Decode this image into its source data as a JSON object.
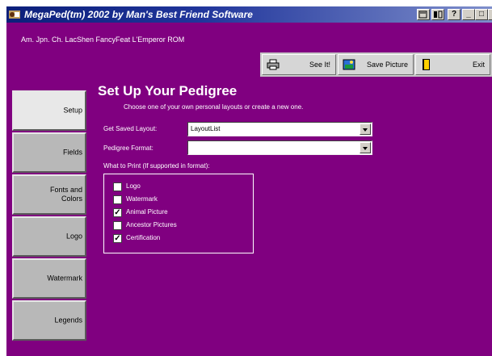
{
  "window": {
    "title": "MegaPed(tm) 2002 by Man's Best Friend Software",
    "controls": [
      "?",
      "_",
      "□",
      "×"
    ]
  },
  "breed_line": "Am. Jpn. Ch. LacShen FancyFeat L'Emperor ROM",
  "toolbar": {
    "see_it": "See It!",
    "save_picture": "Save Picture",
    "exit": "Exit"
  },
  "sidebar": {
    "items": [
      {
        "label": "Setup",
        "active": true
      },
      {
        "label": "Fields",
        "active": false
      },
      {
        "label": "Fonts and\nColors",
        "active": false
      },
      {
        "label": "Logo",
        "active": false
      },
      {
        "label": "Watermark",
        "active": false
      },
      {
        "label": "Legends",
        "active": false
      }
    ]
  },
  "main": {
    "heading": "Set Up Your Pedigree",
    "subtitle": "Choose one of your own personal layouts or create a new one.",
    "saved_layout_label": "Get Saved Layout:",
    "saved_layout_value": "LayoutList",
    "pedigree_format_label": "Pedigree Format:",
    "pedigree_format_value": "",
    "print_group_label": "What to Print (If supported in format):",
    "print_options": [
      {
        "label": "Logo",
        "checked": false
      },
      {
        "label": "Watermark",
        "checked": false
      },
      {
        "label": "Animal Picture",
        "checked": true
      },
      {
        "label": "Ancestor Pictures",
        "checked": false
      },
      {
        "label": "Certification",
        "checked": true
      }
    ]
  },
  "colors": {
    "background": "#800080",
    "titlebar": "#0b1f7a"
  }
}
